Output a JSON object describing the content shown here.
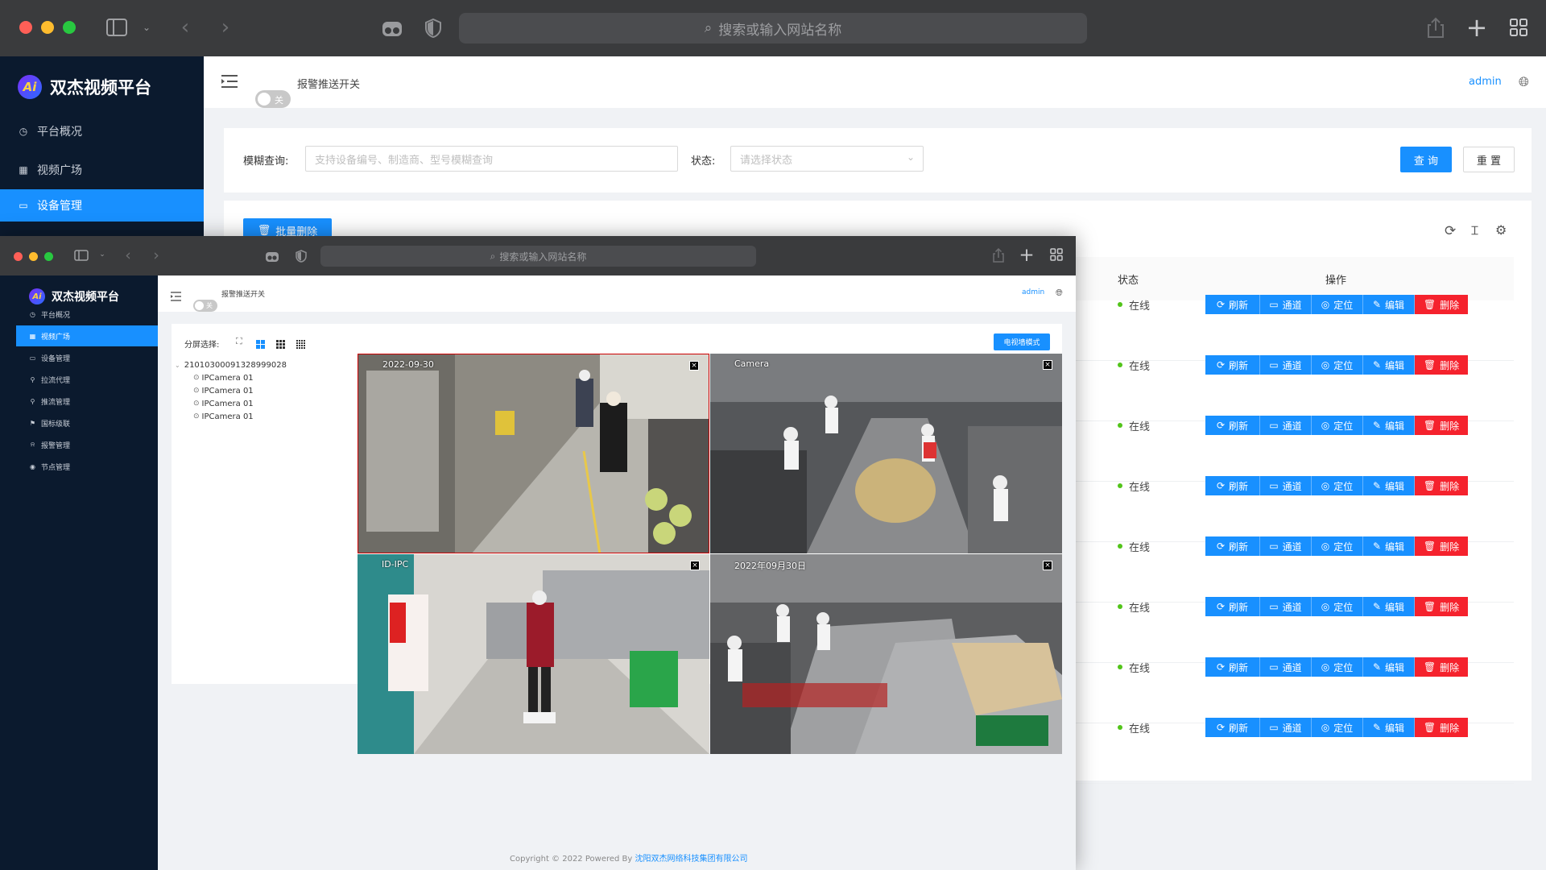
{
  "browser": {
    "url_placeholder": "搜索或输入网站名称"
  },
  "brand": {
    "logo_text": "Ai",
    "name": "双杰视频平台"
  },
  "back": {
    "sidebar": [
      {
        "label": "平台概况",
        "icon": "dashboard-icon"
      },
      {
        "label": "视频广场",
        "icon": "grid-icon"
      },
      {
        "label": "设备管理",
        "icon": "camera-icon",
        "active": true
      }
    ],
    "header": {
      "toggle_state": "关",
      "toggle_label": "报警推送开关",
      "user": "admin"
    },
    "filter": {
      "fuzzy_label": "模糊查询:",
      "fuzzy_placeholder": "支持设备编号、制造商、型号模糊查询",
      "status_label": "状态:",
      "status_placeholder": "请选择状态",
      "query_btn": "查 询",
      "reset_btn": "重 置"
    },
    "toolbar": {
      "batch_delete": "批量删除"
    },
    "table": {
      "col_status": "状态",
      "col_ops": "操作",
      "rows": [
        {
          "status": "在线"
        },
        {
          "status": "在线"
        },
        {
          "status": "在线"
        },
        {
          "status": "在线"
        },
        {
          "status": "在线"
        },
        {
          "status": "在线"
        },
        {
          "status": "在线"
        },
        {
          "status": "在线"
        }
      ],
      "ops": {
        "refresh": "刷新",
        "channel": "通道",
        "locate": "定位",
        "edit": "编辑",
        "delete": "删除"
      }
    }
  },
  "front": {
    "sidebar": [
      {
        "label": "平台概况"
      },
      {
        "label": "视频广场",
        "active": true
      },
      {
        "label": "设备管理"
      },
      {
        "label": "拉流代理"
      },
      {
        "label": "推流管理"
      },
      {
        "label": "国标级联"
      },
      {
        "label": "报警管理"
      },
      {
        "label": "节点管理"
      }
    ],
    "header": {
      "toggle_state": "关",
      "toggle_label": "报警推送开关",
      "user": "admin"
    },
    "split_label": "分屏选择:",
    "tv_wall_btn": "电视墙模式",
    "tree": {
      "root": "21010300091328999028",
      "children": [
        "IPCamera 01",
        "IPCamera 01",
        "IPCamera 01",
        "IPCamera 01"
      ]
    },
    "cams": [
      {
        "overlay": "2022-09-30"
      },
      {
        "overlay": "Camera"
      },
      {
        "overlay": "ID-IPC"
      },
      {
        "overlay": "2022年09月30日"
      }
    ],
    "footer": {
      "copyright": "Copyright © 2022 Powered By",
      "company": "沈阳双杰网络科技集团有限公司"
    }
  },
  "colors": {
    "primary": "#1890ff",
    "danger": "#f5222d",
    "sidebar": "#0b1a2e",
    "online": "#52c41a"
  }
}
